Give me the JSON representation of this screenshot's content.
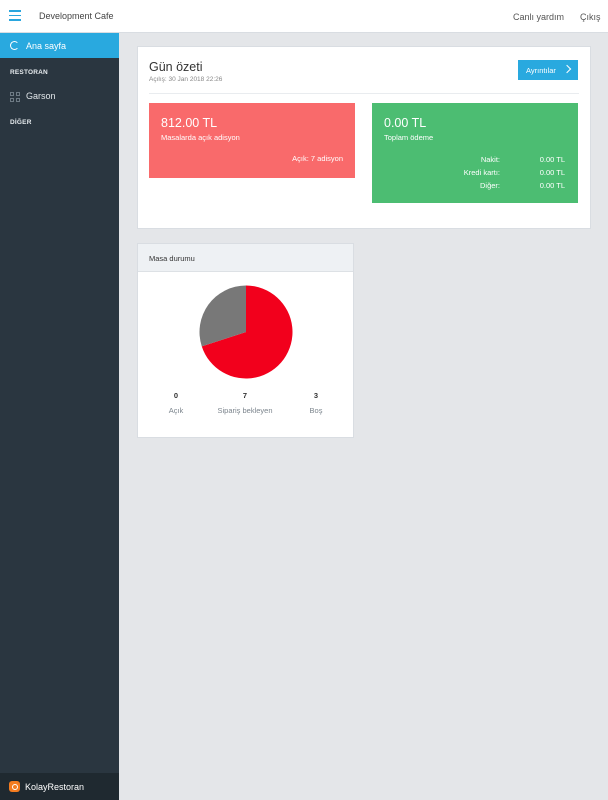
{
  "header": {
    "app_title": "Development Cafe",
    "links": [
      "Canlı yardım",
      "Çıkış"
    ]
  },
  "sidebar": {
    "active_item": "Ana sayfa",
    "section_restaurant": "RESTORAN",
    "item_waiter": "Garson",
    "section_other": "DİĞER",
    "footer_brand": "KolayRestoran"
  },
  "summary": {
    "title": "Gün özeti",
    "subtitle": "Açılış: 30 Jan 2018 22:26",
    "details_button": "Ayrıntılar",
    "open_amount": "812.00 TL",
    "open_label": "Masalarda açık adisyon",
    "open_count": "Açık: 7 adisyon",
    "total_amount": "0.00 TL",
    "total_label": "Toplam ödeme",
    "payments": [
      {
        "label": "Nakit:",
        "value": "0.00 TL"
      },
      {
        "label": "Kredi kartı:",
        "value": "0.00 TL"
      },
      {
        "label": "Diğer:",
        "value": "0.00 TL"
      }
    ]
  },
  "table_status": {
    "title": "Masa durumu",
    "legend": [
      {
        "count": "0",
        "label": "Açık"
      },
      {
        "count": "7",
        "label": "Sipariş bekleyen"
      },
      {
        "count": "3",
        "label": "Boş"
      }
    ]
  },
  "chart_data": {
    "type": "pie",
    "categories": [
      "Açık",
      "Sipariş bekleyen",
      "Boş"
    ],
    "values": [
      0,
      7,
      3
    ],
    "colors": [
      "#29a9df",
      "#f2001c",
      "#787878"
    ]
  },
  "colors": {
    "accent": "#29a9df",
    "sidebar_bg": "#2a3640",
    "red_card": "#f96a6b",
    "green_card": "#4cbd72"
  }
}
